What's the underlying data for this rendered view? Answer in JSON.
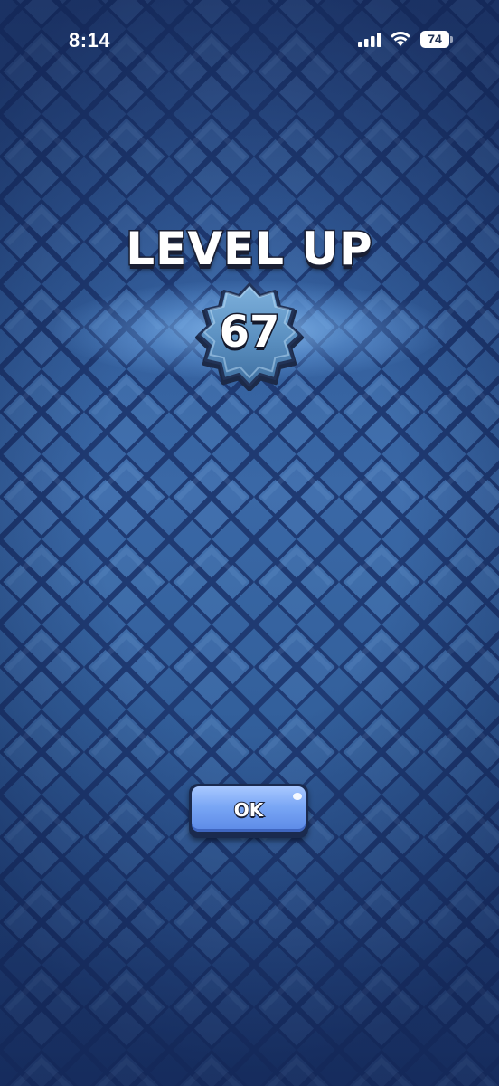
{
  "status_bar": {
    "time": "8:14",
    "battery_level": "74",
    "icons": [
      "cellular-signal-icon",
      "wifi-icon",
      "battery-icon"
    ]
  },
  "level_up": {
    "title": "LEVEL UP",
    "level": "67"
  },
  "ok_button": {
    "label": "OK"
  },
  "colors": {
    "background": "#3563a2",
    "tile_lines": "#1f3a72",
    "badge": "#4f86b6",
    "button": "#79a6f5",
    "text_outline": "#1a1f33"
  }
}
